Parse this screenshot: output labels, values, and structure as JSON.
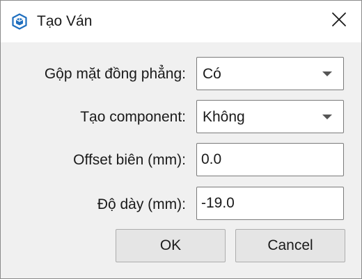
{
  "window": {
    "title": "Tạo Ván",
    "app_icon": "sketchup-cube-icon",
    "close_icon": "close-icon"
  },
  "form": {
    "rows": [
      {
        "label": "Gộp mặt đồng phẳng:",
        "type": "select",
        "value": "Có"
      },
      {
        "label": "Tạo component:",
        "type": "select",
        "value": "Không"
      },
      {
        "label": "Offset biên (mm):",
        "type": "text",
        "value": "0.0"
      },
      {
        "label": "Độ dày (mm):",
        "type": "text",
        "value": "-19.0"
      }
    ]
  },
  "buttons": {
    "ok_label": "OK",
    "cancel_label": "Cancel"
  },
  "colors": {
    "app_icon": "#1f6fbf",
    "window_bg": "#f0f0f0",
    "titlebar_bg": "#ffffff",
    "button_bg": "#e5e5e5"
  }
}
